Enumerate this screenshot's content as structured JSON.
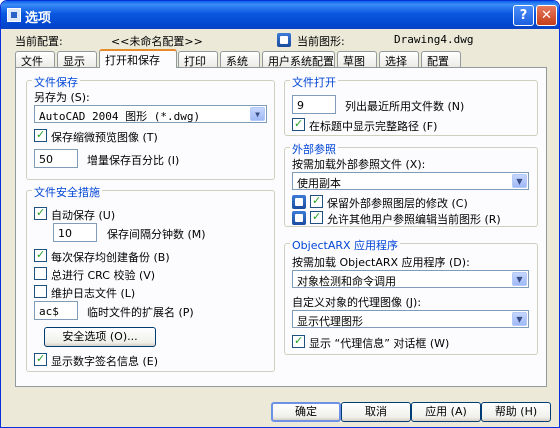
{
  "window": {
    "title": "选项"
  },
  "header": {
    "current_profile_label": "当前配置:",
    "current_profile_value": "<<未命名配置>>",
    "current_drawing_label": "当前图形:",
    "current_drawing_value": "Drawing4.dwg"
  },
  "tabs": [
    {
      "label": "文件"
    },
    {
      "label": "显示"
    },
    {
      "label": "打开和保存"
    },
    {
      "label": "打印"
    },
    {
      "label": "系统"
    },
    {
      "label": "用户系统配置"
    },
    {
      "label": "草图"
    },
    {
      "label": "选择"
    },
    {
      "label": "配置"
    }
  ],
  "file_save": {
    "title": "文件保存",
    "save_as_label": "另存为 (S):",
    "save_as_value": "AutoCAD 2004 图形 (*.dwg)",
    "thumbnail_label": "保存缩微预览图像 (T)",
    "thumbnail_checked": true,
    "increment_value": "50",
    "increment_label": "增量保存百分比 (I)"
  },
  "file_safety": {
    "title": "文件安全措施",
    "autosave_label": "自动保存 (U)",
    "autosave_checked": true,
    "minutes_value": "10",
    "minutes_label": "保存间隔分钟数 (M)",
    "backup_label": "每次保存均创建备份 (B)",
    "backup_checked": true,
    "crc_label": "总进行 CRC 校验 (V)",
    "crc_checked": false,
    "log_label": "维护日志文件 (L)",
    "log_checked": false,
    "temp_ext_value": "ac$",
    "temp_ext_label": "临时文件的扩展名 (P)",
    "security_button": "安全选项 (O)...",
    "signature_label": "显示数字签名信息 (E)",
    "signature_checked": true
  },
  "file_open": {
    "title": "文件打开",
    "recent_value": "9",
    "recent_label": "列出最近所用文件数 (N)",
    "fullpath_label": "在标题中显示完整路径 (F)",
    "fullpath_checked": true
  },
  "xref": {
    "title": "外部参照",
    "demand_load_label": "按需加载外部参照文件 (X):",
    "demand_load_value": "使用副本",
    "retain_label": "保留外部参照图层的修改 (C)",
    "retain_checked": true,
    "allow_edit_label": "允许其他用户参照编辑当前图形 (R)",
    "allow_edit_checked": true
  },
  "objectarx": {
    "title": "ObjectARX 应用程序",
    "demand_load_label": "按需加载 ObjectARX 应用程序 (D):",
    "demand_load_value": "对象检测和命令调用",
    "proxy_images_label": "自定义对象的代理图像 (J):",
    "proxy_images_value": "显示代理图形",
    "proxy_dialog_label": "显示 “代理信息” 对话框 (W)",
    "proxy_dialog_checked": true
  },
  "footer": {
    "ok": "确定",
    "cancel": "取消",
    "apply": "应用 (A)",
    "help": "帮助 (H)"
  }
}
